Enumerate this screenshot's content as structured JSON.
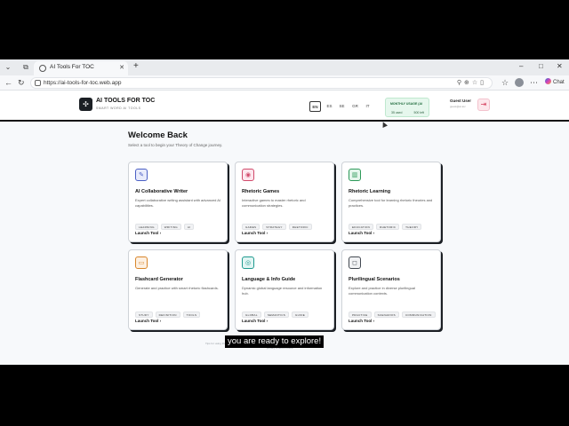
{
  "browser": {
    "tab_title": "AI Tools For TOC",
    "url": "https://ai-tools-for-toc.web.app",
    "chat_label": "Chat"
  },
  "header": {
    "brand_name": "AI TOOLS FOR TOC",
    "brand_tagline": "SMART WORD AI TOOLS",
    "languages": [
      "EN",
      "ES",
      "SE",
      "GR",
      "IT"
    ],
    "active_language": "EN",
    "usage": {
      "title": "MONTHLY USAGE (AI",
      "left": "35 used",
      "right": "500 left"
    },
    "user_name": "Guest User",
    "user_sub": "guest@ai-toc"
  },
  "main": {
    "welcome": "Welcome Back",
    "subtitle": "Select a tool to begin your Theory of Change journey.",
    "cards": [
      {
        "title": "AI Collaborative Writer",
        "desc": "Expert collaborative writing assistant with advanced AI capabilities.",
        "tags": [
          "LEARNING",
          "WRITING",
          "AI"
        ],
        "link": "Launch Tool",
        "icon": "feather-icon",
        "glyph": "✎",
        "color": "#4a5fc4",
        "bg": "#e8ebfb"
      },
      {
        "title": "Rhetoric Games",
        "desc": "Interactive games to master rhetoric and communication strategies.",
        "tags": [
          "GAMES",
          "STRATEGY",
          "RHETORIC"
        ],
        "link": "Launch Tool",
        "icon": "gamepad-icon",
        "glyph": "◉",
        "color": "#d14a6b",
        "bg": "#fde7ee"
      },
      {
        "title": "Rhetoric Learning",
        "desc": "Comprehensive tool for learning rhetoric theories and practices.",
        "tags": [
          "EDUCATION",
          "RHETORIC",
          "THEORY"
        ],
        "link": "Launch Tool",
        "icon": "book-icon",
        "glyph": "▥",
        "color": "#2e9a5a",
        "bg": "#e5f6ec"
      },
      {
        "title": "Flashcard Generator",
        "desc": "Generate and practice with smart rhetoric flashcards.",
        "tags": [
          "STUDY",
          "DEFINITION",
          "TOOLS"
        ],
        "link": "Launch Tool",
        "icon": "cards-icon",
        "glyph": "▭",
        "color": "#d8862b",
        "bg": "#fdf0e2"
      },
      {
        "title": "Language & Info Guide",
        "desc": "Dynamic global language resource and information hub.",
        "tags": [
          "GLOBAL",
          "SEMANTICS",
          "GUIDE"
        ],
        "link": "Launch Tool",
        "icon": "globe-icon",
        "glyph": "◎",
        "color": "#1f9a8f",
        "bg": "#e2f5f3"
      },
      {
        "title": "Plurilingual Scenarios",
        "desc": "Explore and practice in diverse plurilingual communication contexts.",
        "tags": [
          "PRACTICE",
          "SCENARIOS",
          "COMMUNICATION"
        ],
        "link": "Launch Tool",
        "icon": "chat-bubble-icon",
        "glyph": "◻",
        "color": "#444a52",
        "bg": "#f1f2f4"
      }
    ],
    "footer_note": "Tips for using this platform — you are ready to explore the tools below",
    "footer_note2": "privacy & terms notice"
  },
  "caption": "you are ready to explore!"
}
